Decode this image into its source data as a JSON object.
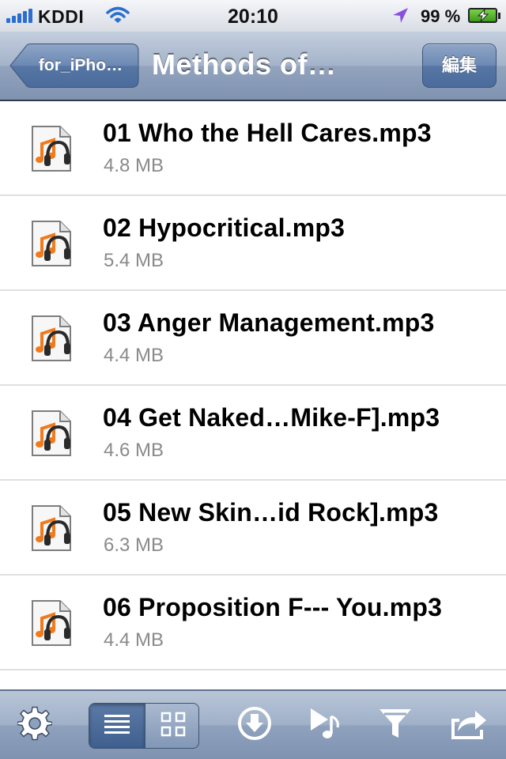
{
  "status_bar": {
    "carrier": "KDDI",
    "time": "20:10",
    "battery_percent": "99 %",
    "signal_bars": 5,
    "wifi_icon": "wifi-icon",
    "location_icon": "location-arrow-icon",
    "battery_icon": "battery-charging-icon"
  },
  "nav": {
    "back_label": "for_iPho…",
    "title": "Methods of…",
    "edit_label": "編集"
  },
  "files": [
    {
      "name": "01 Who the Hell Cares.mp3",
      "size": "4.8 MB",
      "icon": "audio-file-icon"
    },
    {
      "name": "02 Hypocritical.mp3",
      "size": "5.4 MB",
      "icon": "audio-file-icon"
    },
    {
      "name": "03 Anger Management.mp3",
      "size": "4.4 MB",
      "icon": "audio-file-icon"
    },
    {
      "name": "04 Get Naked…Mike-F].mp3",
      "size": "4.6 MB",
      "icon": "audio-file-icon"
    },
    {
      "name": "05 New Skin…id Rock].mp3",
      "size": "6.3 MB",
      "icon": "audio-file-icon"
    },
    {
      "name": "06 Proposition F--- You.mp3",
      "size": "4.4 MB",
      "icon": "audio-file-icon"
    }
  ],
  "toolbar": {
    "items": [
      "gear-icon",
      "list-view-icon",
      "grid-view-icon",
      "download-icon",
      "play-music-icon",
      "filter-icon",
      "share-icon"
    ],
    "selected_view": "list"
  },
  "colors": {
    "nav_bar": "#8a9cb8",
    "toolbar": "#9aabc4",
    "signal": "#2a6fcf",
    "location": "#8a4fe0",
    "battery": "#4fb52a",
    "file_icon_accent": "#f07a1c"
  }
}
